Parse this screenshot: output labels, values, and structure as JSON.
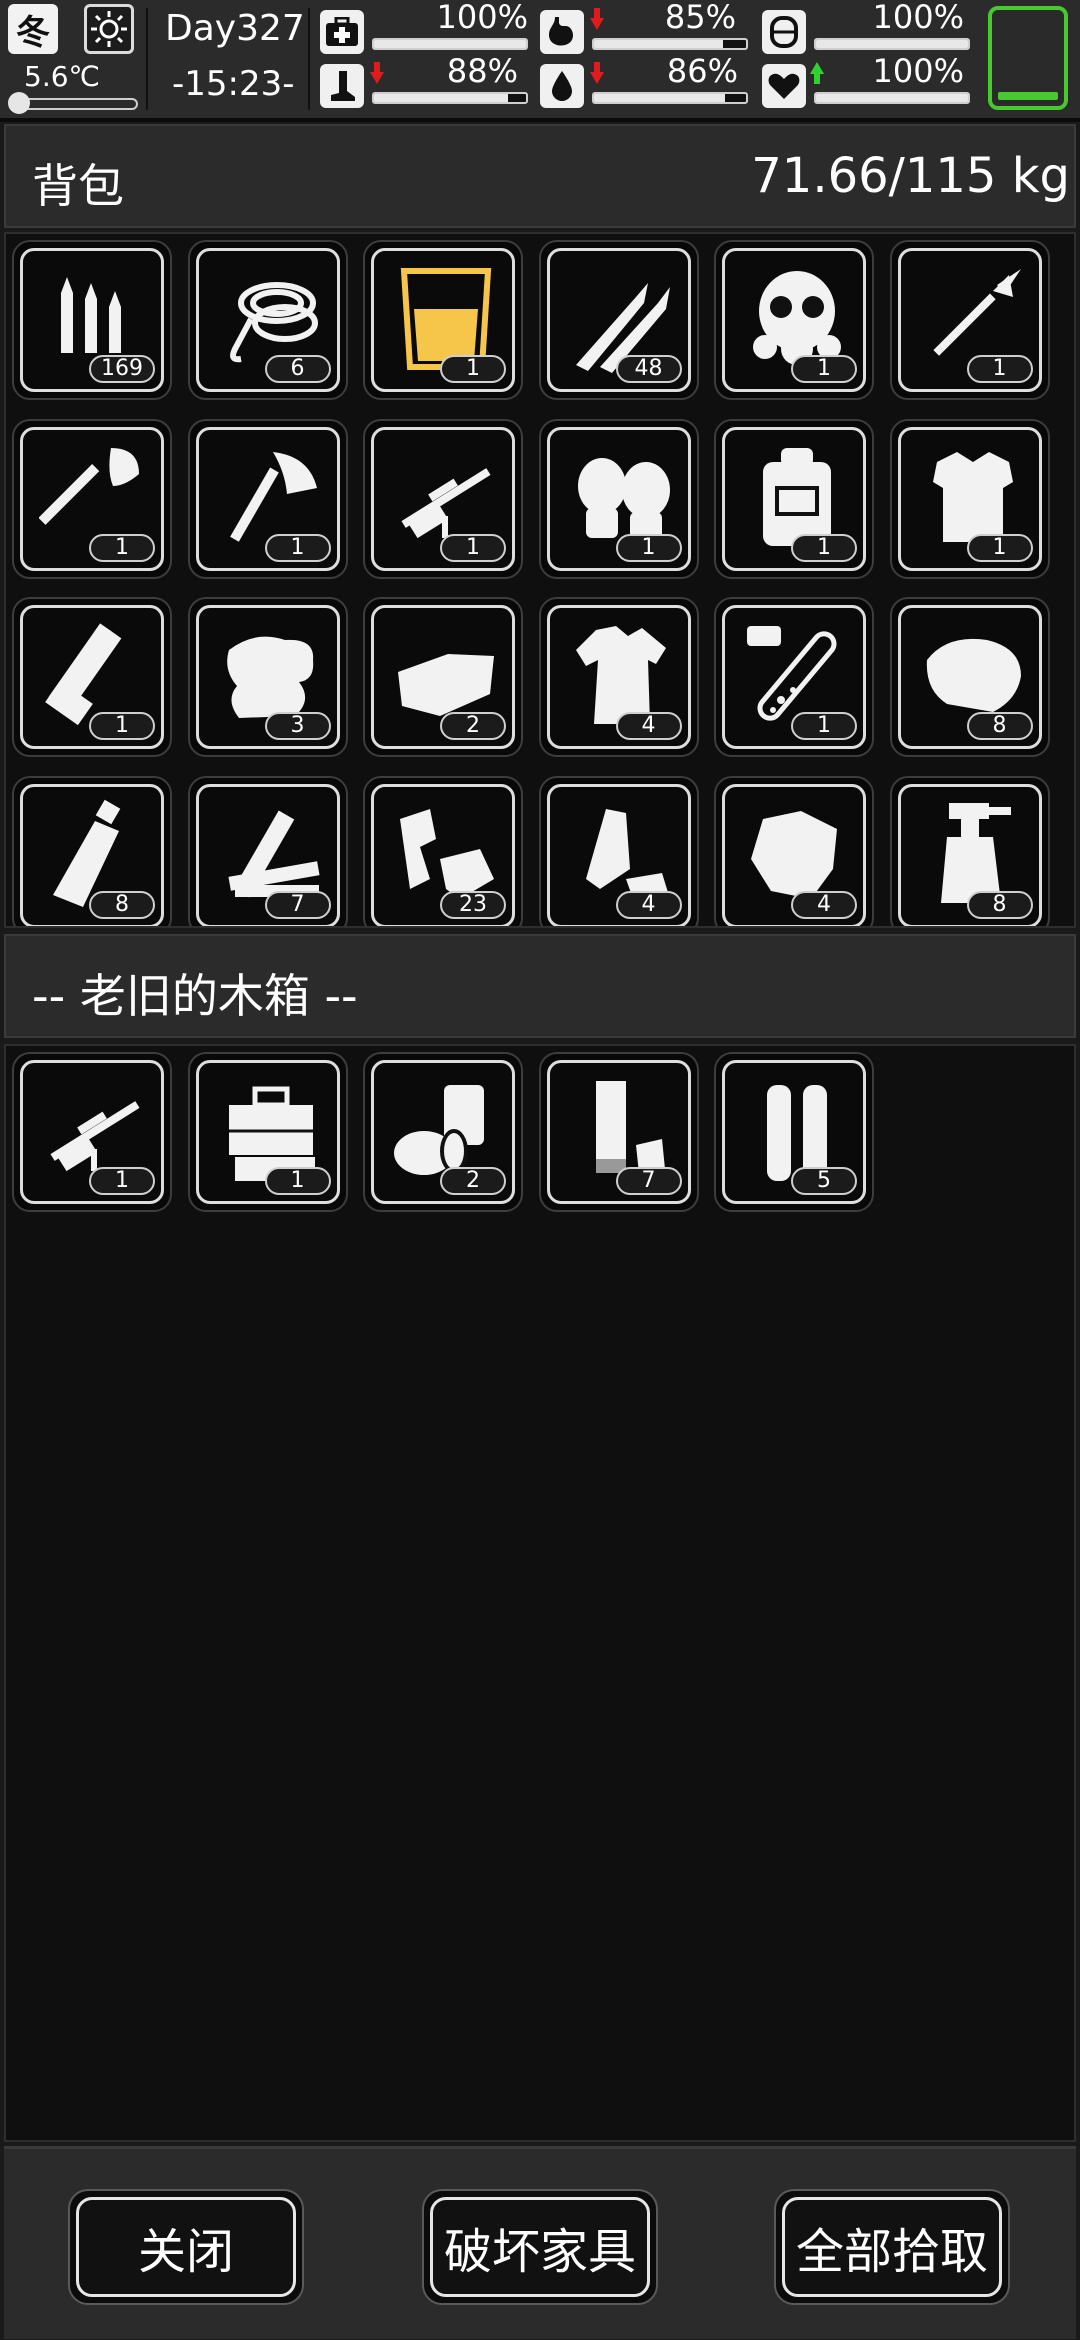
{
  "hud": {
    "season": "冬",
    "weather_icon": "sun-icon",
    "temperature": "5.6℃",
    "day": "Day327",
    "time": "-15:23-",
    "stats": [
      {
        "id": "health",
        "icon": "medkit-icon",
        "value": "100%",
        "fill": 1.0,
        "trend": "none"
      },
      {
        "id": "hunger",
        "icon": "stomach-icon",
        "value": "85%",
        "fill": 0.85,
        "trend": "down"
      },
      {
        "id": "armor",
        "icon": "vest-icon",
        "value": "100%",
        "fill": 1.0,
        "trend": "none"
      },
      {
        "id": "stamina",
        "icon": "leg-icon",
        "value": "88%",
        "fill": 0.88,
        "trend": "down"
      },
      {
        "id": "thirst",
        "icon": "water-drop-icon",
        "value": "86%",
        "fill": 0.86,
        "trend": "down"
      },
      {
        "id": "mood",
        "icon": "heart-icon",
        "value": "100%",
        "fill": 1.0,
        "trend": "up"
      }
    ],
    "battery_color": "#47c92f"
  },
  "backpack": {
    "title": "背包",
    "weight": "71.66/115 kg",
    "items": [
      {
        "icon": "bullets-icon",
        "count": "169"
      },
      {
        "icon": "rope-icon",
        "count": "6"
      },
      {
        "icon": "juice-cup-icon",
        "count": "1"
      },
      {
        "icon": "rifle-rounds-icon",
        "count": "48"
      },
      {
        "icon": "gas-mask-icon",
        "count": "1"
      },
      {
        "icon": "spear-icon",
        "count": "1"
      },
      {
        "icon": "shovel-icon",
        "count": "1"
      },
      {
        "icon": "axe-icon",
        "count": "1"
      },
      {
        "icon": "sniper-rifle-icon",
        "count": "1"
      },
      {
        "icon": "knee-pads-icon",
        "count": "1"
      },
      {
        "icon": "backpack-icon",
        "count": "1"
      },
      {
        "icon": "body-armor-icon",
        "count": "1"
      },
      {
        "icon": "minigun-icon",
        "count": "1"
      },
      {
        "icon": "cloth-icon",
        "count": "3"
      },
      {
        "icon": "paper-icon",
        "count": "2"
      },
      {
        "icon": "torn-shirt-icon",
        "count": "4"
      },
      {
        "icon": "test-tube-icon",
        "count": "1"
      },
      {
        "icon": "meat-icon",
        "count": "8"
      },
      {
        "icon": "bottle-icon",
        "count": "8"
      },
      {
        "icon": "wood-planks-icon",
        "count": "7"
      },
      {
        "icon": "scrap-icon",
        "count": "23"
      },
      {
        "icon": "plastic-trash-icon",
        "count": "4"
      },
      {
        "icon": "crumpled-paper-icon",
        "count": "4"
      },
      {
        "icon": "spray-bottle-icon",
        "count": "8"
      }
    ]
  },
  "container": {
    "title": "-- 老旧的木箱 --",
    "items": [
      {
        "icon": "sniper-rifle-icon",
        "count": "1"
      },
      {
        "icon": "toolbox-icon",
        "count": "1"
      },
      {
        "icon": "cans-icon",
        "count": "2"
      },
      {
        "icon": "shotgun-shells-icon",
        "count": "7"
      },
      {
        "icon": "large-shells-icon",
        "count": "5"
      }
    ]
  },
  "buttons": {
    "close": "关闭",
    "destroy": "破坏家具",
    "take_all": "全部拾取"
  },
  "colors": {
    "accent_green": "#47c92f",
    "down_arrow": "#e01b1b",
    "up_arrow": "#2fd22f",
    "juice_yellow": "#f5c64a"
  }
}
